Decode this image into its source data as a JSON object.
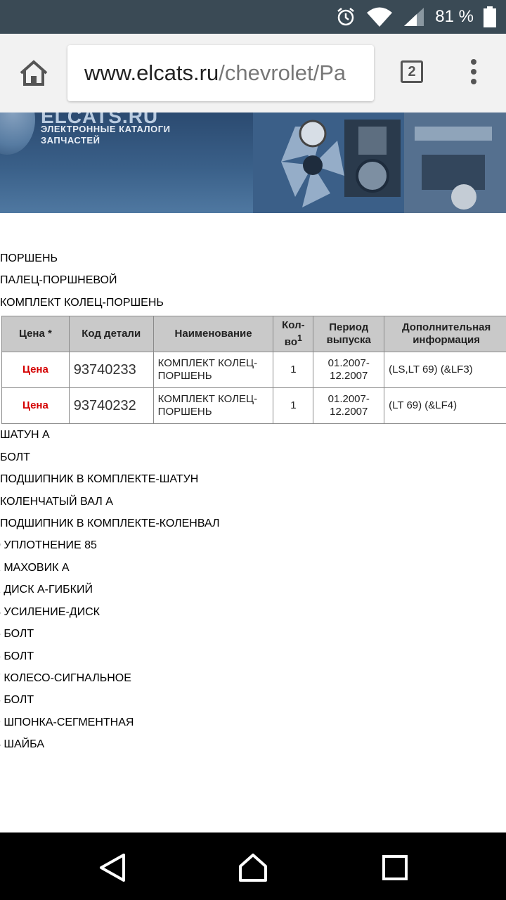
{
  "status_bar": {
    "battery_percent": "81 %",
    "icons": [
      "alarm-icon",
      "wifi-icon",
      "signal-icon",
      "battery-icon"
    ]
  },
  "browser": {
    "url_host": "www.elcats.ru",
    "url_path": "/chevrolet/Pa",
    "tab_count": "2"
  },
  "banner": {
    "logo": "ELCATS.RU",
    "subtitle_line1": "ЭЛЕКТРОННЫЕ КАТАЛОГИ",
    "subtitle_line2": "ЗАПЧАСТЕЙ"
  },
  "parts_above": [
    "ПОРШЕНЬ",
    "ПАЛЕЦ-ПОРШНЕВОЙ",
    "КОМПЛЕКТ КОЛЕЦ-ПОРШЕНЬ"
  ],
  "table": {
    "headers": {
      "price": "Цена *",
      "code": "Код детали",
      "name": "Наименование",
      "qty": "Кол-во",
      "qty_sup": "1",
      "period": "Период выпуска",
      "info": "Дополнительная информация"
    },
    "rows": [
      {
        "price": "Цена",
        "code": "93740233",
        "name": "КОМПЛЕКТ КОЛЕЦ-ПОРШЕНЬ",
        "qty": "1",
        "period": "01.2007-12.2007",
        "info": "(LS,LT 69) (&LF3)"
      },
      {
        "price": "Цена",
        "code": "93740232",
        "name": "КОМПЛЕКТ КОЛЕЦ-ПОРШЕНЬ",
        "qty": "1",
        "period": "01.2007-12.2007",
        "info": "(LT 69) (&LF4)"
      }
    ]
  },
  "parts_below": [
    "ШАТУН А",
    "БОЛТ",
    "ПОДШИПНИК В КОМПЛЕКТЕ-ШАТУН",
    "КОЛЕНЧАТЫЙ ВАЛ А",
    "ПОДШИПНИК В КОМПЛЕКТЕ-КОЛЕНВАЛ",
    "0 УПЛОТНЕНИЕ 85",
    "1 МАХОВИК А",
    "2 ДИСК А-ГИБКИЙ",
    "4 УСИЛЕНИЕ-ДИСК",
    "5 БОЛТ",
    "6 БОЛТ",
    "7 КОЛЕСО-СИГНАЛЬНОЕ",
    "8 БОЛТ",
    "9 ШПОНКА-СЕГМЕНТНАЯ",
    "4 ШАЙБА"
  ],
  "nav_icons": [
    "back-icon",
    "home-icon",
    "recents-icon"
  ]
}
